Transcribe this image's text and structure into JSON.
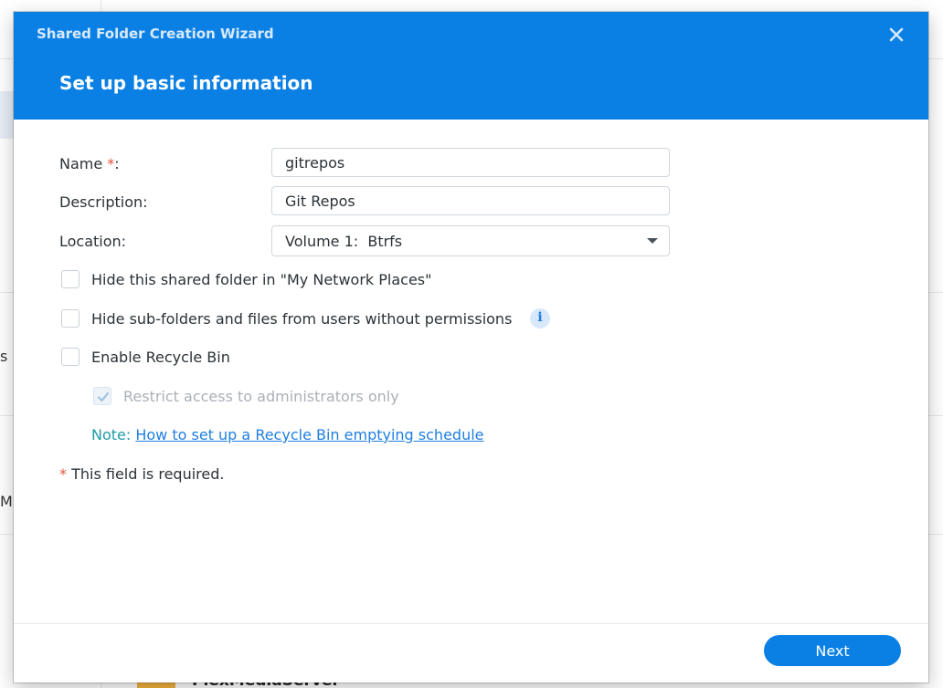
{
  "background": {
    "partial_text_1": "s",
    "partial_text_2": "M",
    "folder_name": "PlexMediaServer"
  },
  "wizard": {
    "title": "Shared Folder Creation Wizard",
    "step_title": "Set up basic information",
    "close_icon": "close-icon"
  },
  "form": {
    "name_label": "Name",
    "name_required_marker": "*",
    "name_colon": ":",
    "name_value": "gitrepos",
    "description_label": "Description:",
    "description_value": "Git Repos",
    "location_label": "Location:",
    "location_value": "Volume 1:  Btrfs"
  },
  "options": {
    "hide_network_places": {
      "label": "Hide this shared folder in \"My Network Places\"",
      "checked": false
    },
    "hide_subfolders": {
      "label": "Hide sub-folders and files from users without permissions",
      "checked": false
    },
    "info_icon": "i",
    "enable_recycle_bin": {
      "label": "Enable Recycle Bin",
      "checked": false
    },
    "restrict_admins": {
      "label": "Restrict access to administrators only",
      "checked": true,
      "disabled": true
    }
  },
  "note": {
    "label": "Note:",
    "link_text": "How to set up a Recycle Bin emptying schedule"
  },
  "required_note": {
    "marker": "*",
    "text": "This field is required."
  },
  "footer": {
    "next_label": "Next"
  },
  "colors": {
    "accent": "#0b80e4",
    "required": "#e2513b",
    "note_label": "#1d9ba6",
    "link": "#1f7fe0"
  }
}
